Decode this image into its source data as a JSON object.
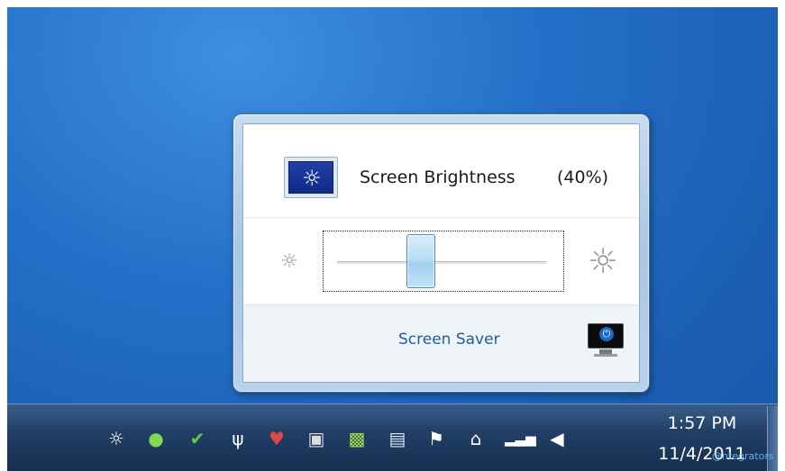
{
  "flyout": {
    "title": "Screen Brightness",
    "percent_label": "(40%)",
    "brightness_value": 0.4,
    "screen_saver_link": "Screen Saver",
    "icons": {
      "header": "brightness-monitor-icon",
      "slider_min": "sun-small-icon",
      "slider_max": "sun-large-icon",
      "screen_saver": "monitor-power-icon"
    }
  },
  "taskbar": {
    "tray_icons": [
      "brightness-icon",
      "green-shield-icon",
      "green-check-icon",
      "wireless-icon",
      "gmail-icon",
      "camera-icon",
      "green-app-icon",
      "network-icon",
      "flag-icon",
      "power-plug-icon",
      "signal-bars-icon",
      "volume-icon"
    ],
    "clock_time": "1:57 PM",
    "clock_date": "11/4/2011"
  },
  "watermark": "@ntegrators",
  "colors": {
    "desktop": "#2470c8",
    "link": "#1f5d9b",
    "taskbar": "#223f66"
  }
}
